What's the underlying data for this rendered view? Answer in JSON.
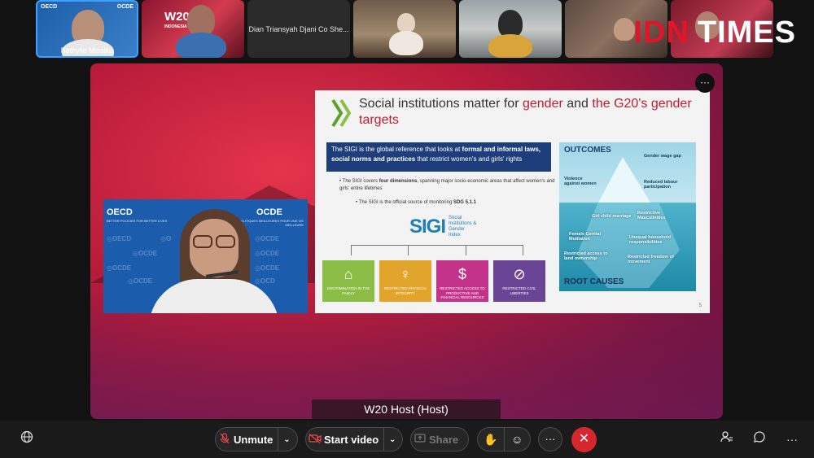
{
  "participants": [
    {
      "name": "Bathylle Missika",
      "active": true,
      "logos": [
        "OECD",
        "OCDE"
      ]
    },
    {
      "name": "",
      "logo": "W20",
      "logo_sub": "INDONESIA"
    },
    {
      "name": "Dian Triansyah Djani Co She..."
    },
    {
      "name": ""
    },
    {
      "name": ""
    },
    {
      "name": ""
    },
    {
      "name": ""
    }
  ],
  "brand": {
    "part1": "IDN",
    "part2": "TIMES"
  },
  "stage": {
    "more_label": "···"
  },
  "slide": {
    "title_a": "Social institutions matter for ",
    "title_b": "gender",
    "title_c": " and ",
    "title_d": "the G20's",
    "title_e": " gender targets",
    "ref_a": "The SIGI is the global reference that looks at ",
    "ref_b": "formal and informal laws, social norms and practices",
    "ref_c": " that restrict women's and girls' rights",
    "bullet1_a": "The SIGI covers ",
    "bullet1_b": "four dimensions",
    "bullet1_c": ", spanning major socio-economic areas that affect women's and girls' entire lifetimes",
    "bullet2_a": "The SIGI is the official source of monitoring ",
    "bullet2_b": "SDG 5.1.1",
    "sigi_mark": "SIGI",
    "sigi_line1": "Social",
    "sigi_line2": "Institutions &",
    "sigi_line3": "Gender",
    "sigi_line4": "Index",
    "dimensions": [
      {
        "label": "DISCRIMINATION IN THE FAMILY",
        "color": "#8cbd46"
      },
      {
        "label": "RESTRICTED PHYSICAL INTEGRITY",
        "color": "#e0a52a"
      },
      {
        "label": "RESTRICTED ACCESS TO PRODUCTIVE AND FINANCIAL RESOURCES",
        "color": "#c3338a"
      },
      {
        "label": "RESTRICTED CIVIL LIBERTIES",
        "color": "#6a4596"
      }
    ],
    "iceberg": {
      "outcomes": "OUTCOMES",
      "root_causes": "ROOT CAUSES",
      "labels": [
        "Gender wage gap",
        "Violence against women",
        "Reduced labour participation",
        "Girl child marriage",
        "Restrictive Masculinities",
        "Female Genital Mutilation",
        "Unequal household responsibilities",
        "Restricted access to land ownership",
        "Restricted freedom of movement"
      ]
    },
    "page_number": "5"
  },
  "pip": {
    "logo_left": "OECD",
    "logo_right": "OCDE",
    "sub_left": "BETTER POLICIES FOR BETTER LIVES",
    "sub_right": "DES POLITIQUES MEILLEURES POUR UNE VIE MEILLEURE"
  },
  "host_label": "W20 Host  (Host)",
  "toolbar": {
    "unmute": "Unmute",
    "start_video": "Start video",
    "share": "Share"
  }
}
